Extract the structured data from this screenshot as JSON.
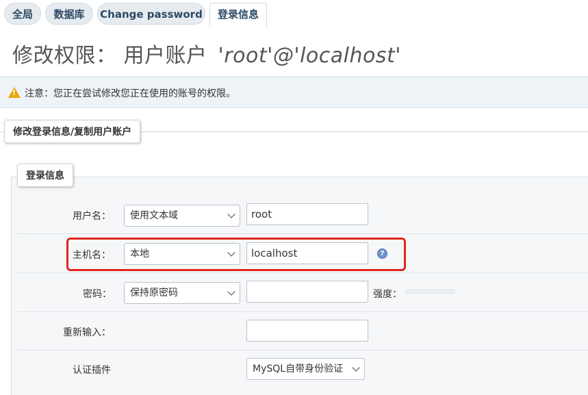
{
  "tabs": [
    {
      "label": "全局"
    },
    {
      "label": "数据库"
    },
    {
      "label": "Change password"
    },
    {
      "label": "登录信息"
    }
  ],
  "title": {
    "prefix": "修改权限：  用户账户",
    "account": "'root'@'localhost'"
  },
  "notice": {
    "icon": "warning-icon",
    "text": "注意：您正在尝试修改您正在使用的账号的权限。"
  },
  "outer_legend": "修改登录信息/复制用户账户",
  "inner_legend": "登录信息",
  "form": {
    "username": {
      "label": "用户名：",
      "select": "使用文本域",
      "value": "root"
    },
    "hostname": {
      "label": "主机名：",
      "select": "本地",
      "value": "localhost",
      "help_icon": "help-icon"
    },
    "password": {
      "label": "密码：",
      "select": "保持原密码",
      "value": "",
      "strength_label": "强度："
    },
    "retype": {
      "label": "重新输入：",
      "value": ""
    },
    "auth_plugin": {
      "label": "认证插件",
      "select": "MySQL自带身份验证"
    }
  },
  "colors": {
    "highlight": "#e0251e",
    "tab_text": "#2c4a64",
    "warning": "#e8a800"
  }
}
